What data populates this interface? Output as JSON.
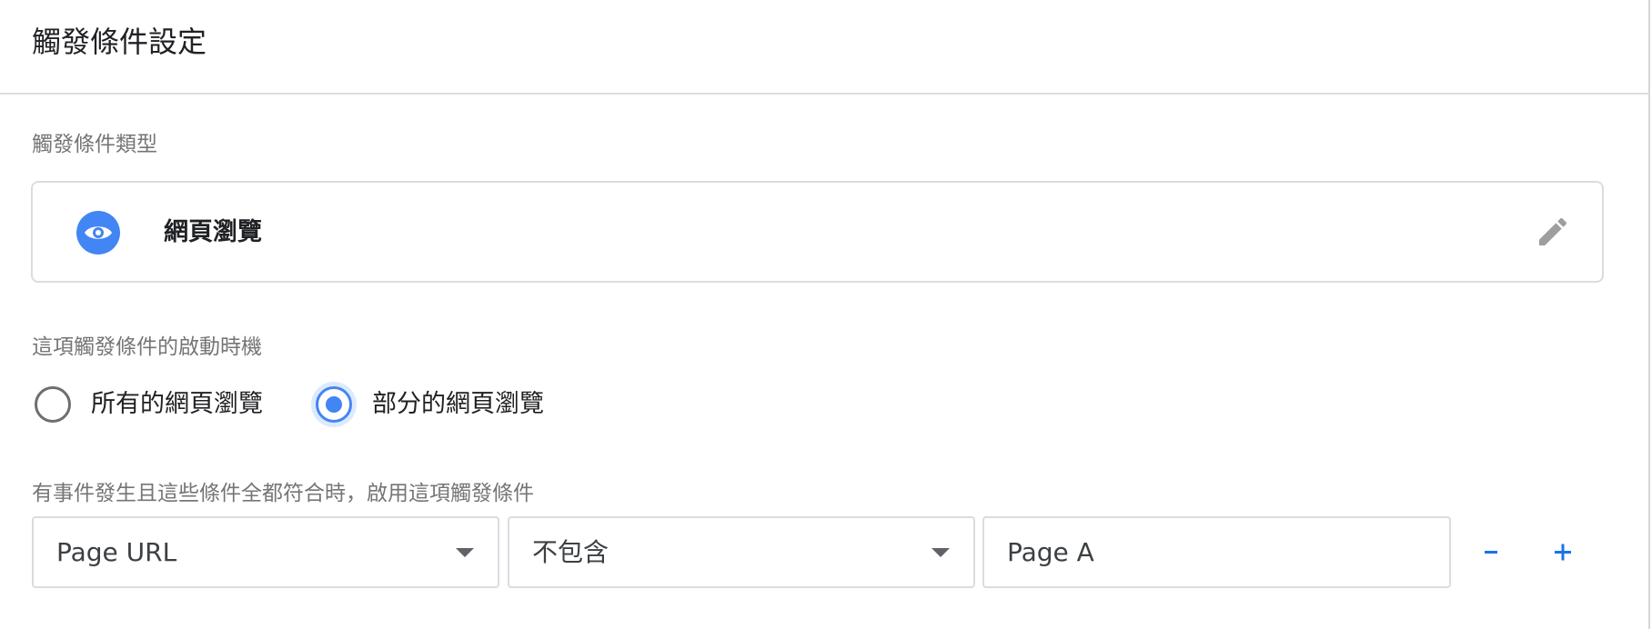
{
  "panel": {
    "title": "觸發條件設定"
  },
  "trigger_type": {
    "label": "觸發條件類型",
    "name": "網頁瀏覽",
    "icon": "eye-icon",
    "edit_icon": "pencil-icon",
    "accent_color": "#4285f4"
  },
  "fire_on": {
    "label": "這項觸發條件的啟動時機",
    "options": [
      {
        "label": "所有的網頁瀏覽",
        "selected": false
      },
      {
        "label": "部分的網頁瀏覽",
        "selected": true
      }
    ]
  },
  "conditions": {
    "label": "有事件發生且這些條件全都符合時，啟用這項觸發條件",
    "rows": [
      {
        "variable": "Page URL",
        "operator": "不包含",
        "value": "Page A"
      }
    ],
    "remove_label": "−",
    "add_label": "+",
    "button_color": "#1a73e8"
  }
}
